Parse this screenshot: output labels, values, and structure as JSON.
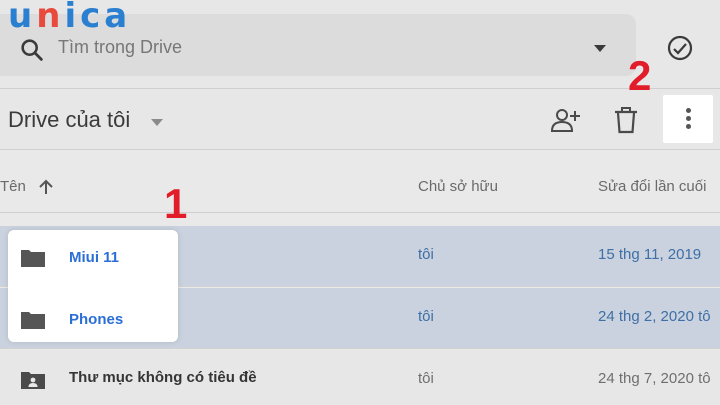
{
  "logo": {
    "text_u": "u",
    "text_n": "n",
    "text_rest": "ica"
  },
  "search": {
    "placeholder": "Tìm trong Drive"
  },
  "toolbar": {
    "title": "Drive của tôi"
  },
  "columns": {
    "name": "Tên",
    "owner": "Chủ sở hữu",
    "modified": "Sửa đổi lần cuối"
  },
  "files": [
    {
      "name": "Miui 11",
      "owner": "tôi",
      "modified": "15 thg 11, 2019",
      "icon": "folder-icon",
      "selected": true
    },
    {
      "name": "Phones",
      "owner": "tôi",
      "modified": "24 thg 2, 2020 tô",
      "icon": "folder-icon",
      "selected": true
    },
    {
      "name": "Thư mục không có tiêu đề",
      "owner": "tôi",
      "modified": "24 thg 7, 2020 tô",
      "icon": "shared-folder-icon",
      "selected": false
    }
  ],
  "steps": {
    "step1": "1",
    "step2": "2"
  },
  "colors": {
    "accent": "#2b6fd6",
    "step_marker": "#e11d2a",
    "selected_row": "#c9d2de"
  }
}
